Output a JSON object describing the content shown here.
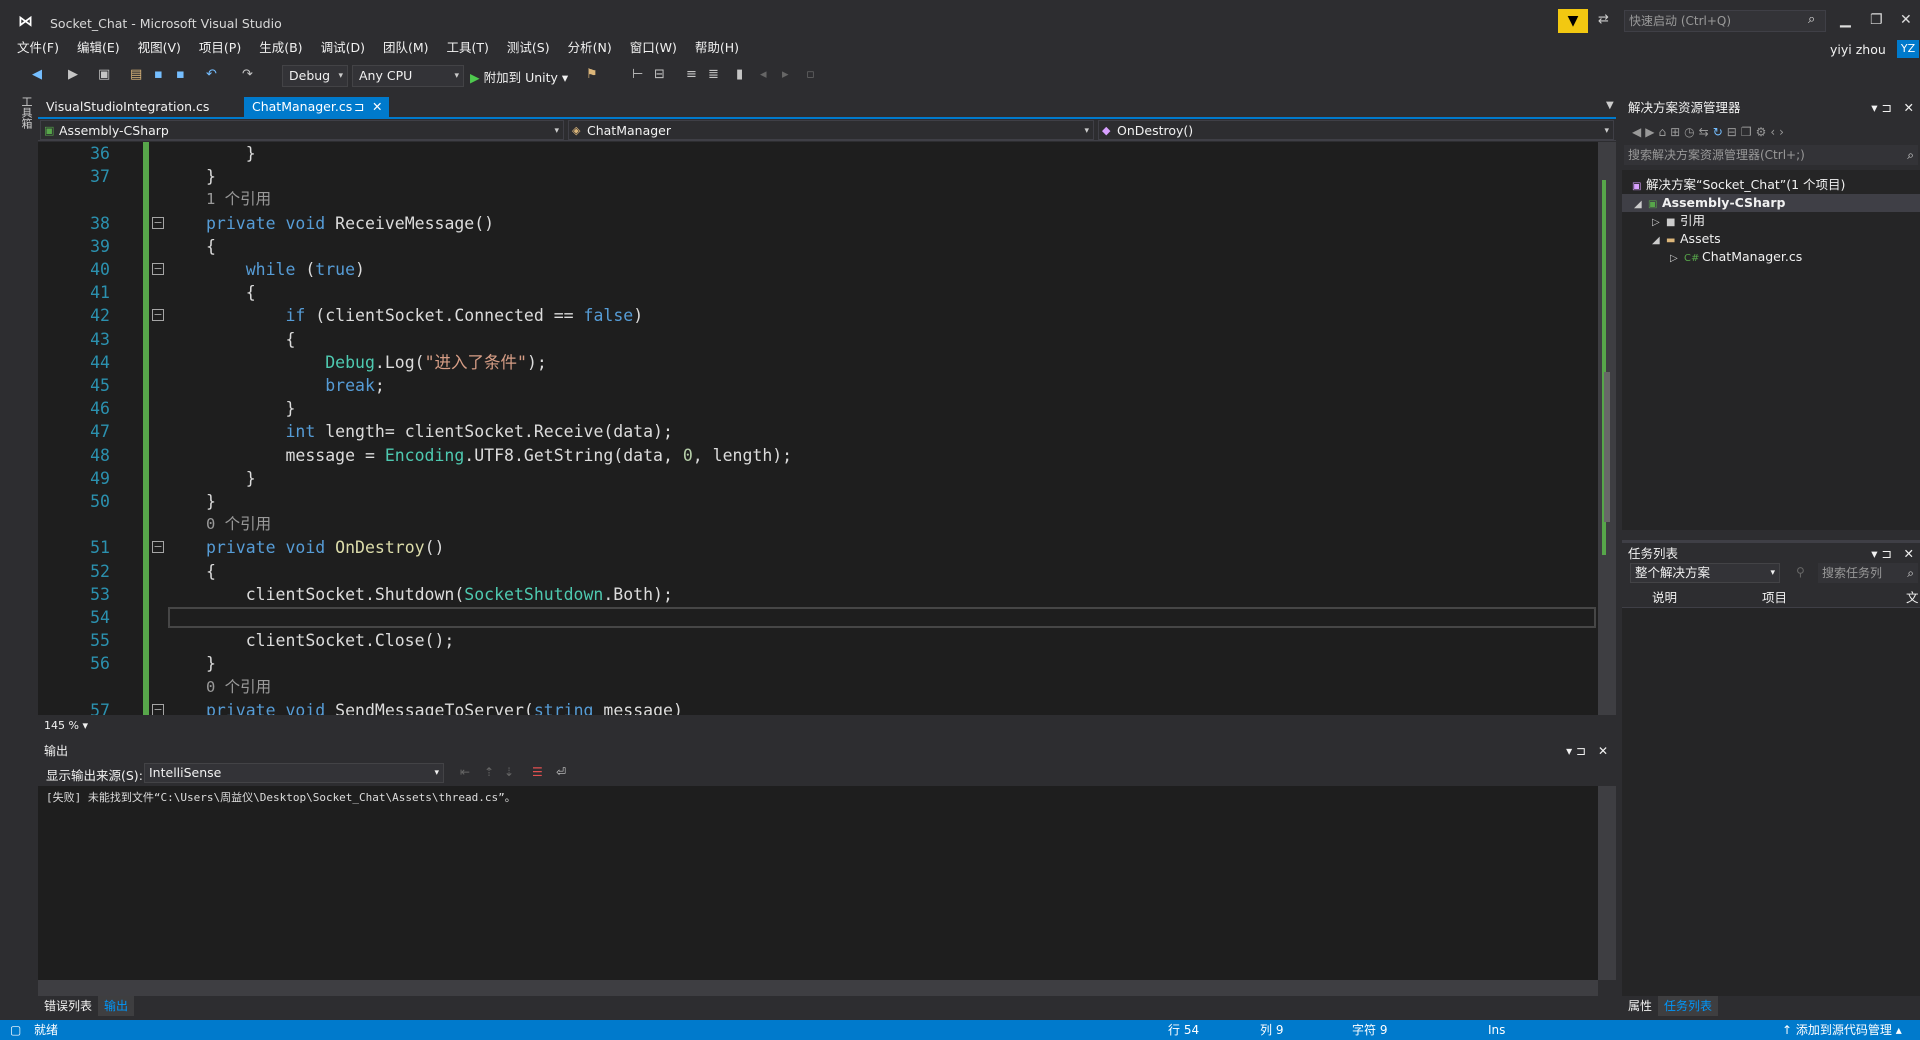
{
  "window": {
    "title": "Socket_Chat - Microsoft Visual Studio",
    "quick_launch_placeholder": "快速启动 (Ctrl+Q)",
    "user": "yiyi zhou",
    "avatar": "YZ"
  },
  "menu": [
    "文件(F)",
    "编辑(E)",
    "视图(V)",
    "项目(P)",
    "生成(B)",
    "调试(D)",
    "团队(M)",
    "工具(T)",
    "测试(S)",
    "分析(N)",
    "窗口(W)",
    "帮助(H)"
  ],
  "toolbar": {
    "config": "Debug",
    "platform": "Any CPU",
    "attach": "附加到 Unity"
  },
  "left_rail": {
    "toolbox": "工具箱"
  },
  "tabs": [
    {
      "label": "VisualStudioIntegration.cs"
    },
    {
      "label": "ChatManager.cs",
      "pin": "⊐",
      "close": "✕"
    }
  ],
  "navbar": {
    "project": "Assembly-CSharp",
    "class": "ChatManager",
    "member": "OnDestroy()"
  },
  "editor": {
    "zoom": "145 %",
    "lines": [
      {
        "n": "36",
        "indent": 1,
        "html": "    }"
      },
      {
        "n": "37",
        "indent": 0,
        "html": "}"
      },
      {
        "ref": "1 个引用"
      },
      {
        "n": "38",
        "fold": true,
        "html": "<span class=\"kw\">private</span> <span class=\"kw\">void</span> ReceiveMessage()"
      },
      {
        "n": "39",
        "html": "{"
      },
      {
        "n": "40",
        "fold": true,
        "html": "    <span class=\"kw\">while</span> (<span class=\"kw\">true</span>)"
      },
      {
        "n": "41",
        "html": "    {"
      },
      {
        "n": "42",
        "fold": true,
        "html": "        <span class=\"kw\">if</span> (clientSocket.Connected == <span class=\"kw\">false</span>)"
      },
      {
        "n": "43",
        "html": "        {"
      },
      {
        "n": "44",
        "html": "            <span class=\"ty\">Debug</span>.Log(<span class=\"st\">\"进入了条件\"</span>);"
      },
      {
        "n": "45",
        "html": "            <span class=\"kw\">break</span>;"
      },
      {
        "n": "46",
        "html": "        }"
      },
      {
        "n": "47",
        "html": "        <span class=\"kw\">int</span> length= clientSocket.Receive(data);"
      },
      {
        "n": "48",
        "html": "        message = <span class=\"ty\">Encoding</span>.UTF8.GetString(data, <span class=\"nu\">0</span>, length);"
      },
      {
        "n": "49",
        "html": "    }"
      },
      {
        "n": "50",
        "html": "}"
      },
      {
        "ref": "0 个引用"
      },
      {
        "n": "51",
        "fold": true,
        "html": "<span class=\"kw\">private</span> <span class=\"kw\">void</span> <span style=\"color:#dcdcaa\">OnDestroy</span>()"
      },
      {
        "n": "52",
        "html": "{"
      },
      {
        "n": "53",
        "html": "    clientSocket.Shutdown(<span class=\"ty\">SocketShutdown</span>.Both);"
      },
      {
        "n": "54",
        "html": "",
        "current": true
      },
      {
        "n": "55",
        "html": "    clientSocket.Close();"
      },
      {
        "n": "56",
        "html": "}"
      },
      {
        "ref": "0 个引用"
      },
      {
        "n": "57",
        "fold": true,
        "html": "<span class=\"kw\">private</span> <span class=\"kw\">void</span> SendMessageToServer(<span class=\"kw\">string</span> message)"
      }
    ]
  },
  "output": {
    "title": "输出",
    "source_label": "显示输出来源(S):",
    "source_value": "IntelliSense",
    "text": "[失败] 未能找到文件“C:\\Users\\周益仪\\Desktop\\Socket_Chat\\Assets\\thread.cs”。"
  },
  "bottom_tabs": [
    "错误列表",
    "输出"
  ],
  "solution_explorer": {
    "title": "解决方案资源管理器",
    "search_placeholder": "搜索解决方案资源管理器(Ctrl+;)",
    "items": [
      {
        "label": "解决方案“Socket_Chat”(1 个项目)",
        "level": 0
      },
      {
        "label": "Assembly-CSharp",
        "level": 1,
        "selected": true
      },
      {
        "label": "引用",
        "level": 2
      },
      {
        "label": "Assets",
        "level": 2
      },
      {
        "label": "ChatManager.cs",
        "level": 3
      }
    ]
  },
  "task_list": {
    "title": "任务列表",
    "scope": "整个解决方案",
    "search_placeholder": "搜索任务列",
    "columns": [
      "说明",
      "项目",
      "文"
    ]
  },
  "right_bottom_tabs": [
    "属性",
    "任务列表"
  ],
  "status": {
    "ready": "就绪",
    "line": "行 54",
    "col": "列 9",
    "char": "字符 9",
    "mode": "Ins",
    "source_control": "添加到源代码管理"
  },
  "colors": {
    "accent": "#007acc",
    "filter": "#f2c811",
    "change_bar": "#57a64a"
  }
}
